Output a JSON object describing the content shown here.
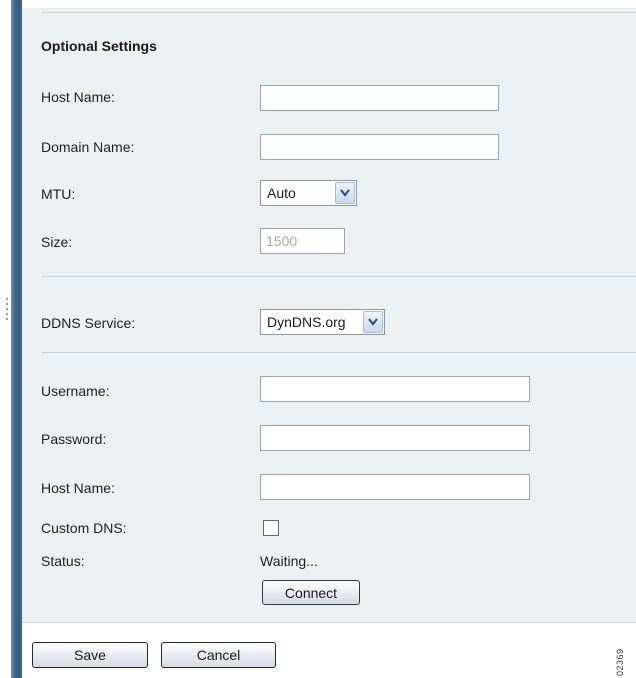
{
  "optional_settings": {
    "title": "Optional Settings",
    "host_name_label": "Host Name:",
    "host_name_value": "",
    "domain_name_label": "Domain Name:",
    "domain_name_value": "",
    "mtu_label": "MTU:",
    "mtu_value": "Auto",
    "size_label": "Size:",
    "size_value": "1500"
  },
  "ddns": {
    "service_label": "DDNS Service:",
    "service_value": "DynDNS.org",
    "username_label": "Username:",
    "username_value": "",
    "password_label": "Password:",
    "password_value": "",
    "host_name_label": "Host Name:",
    "host_name_value": "",
    "custom_dns_label": "Custom DNS:",
    "custom_dns_checked": false,
    "status_label": "Status:",
    "status_value": "Waiting...",
    "connect_label": "Connect"
  },
  "footer": {
    "save_label": "Save",
    "cancel_label": "Cancel"
  },
  "figure_id": "02369",
  "icons": {
    "dropdown_arrow": "chevron-down-icon",
    "side_grip": "grip-icon"
  },
  "colors": {
    "panel_bg": "#edf0f3",
    "accent_bar": "#2f5d80",
    "divider": "#c9d0d6"
  }
}
